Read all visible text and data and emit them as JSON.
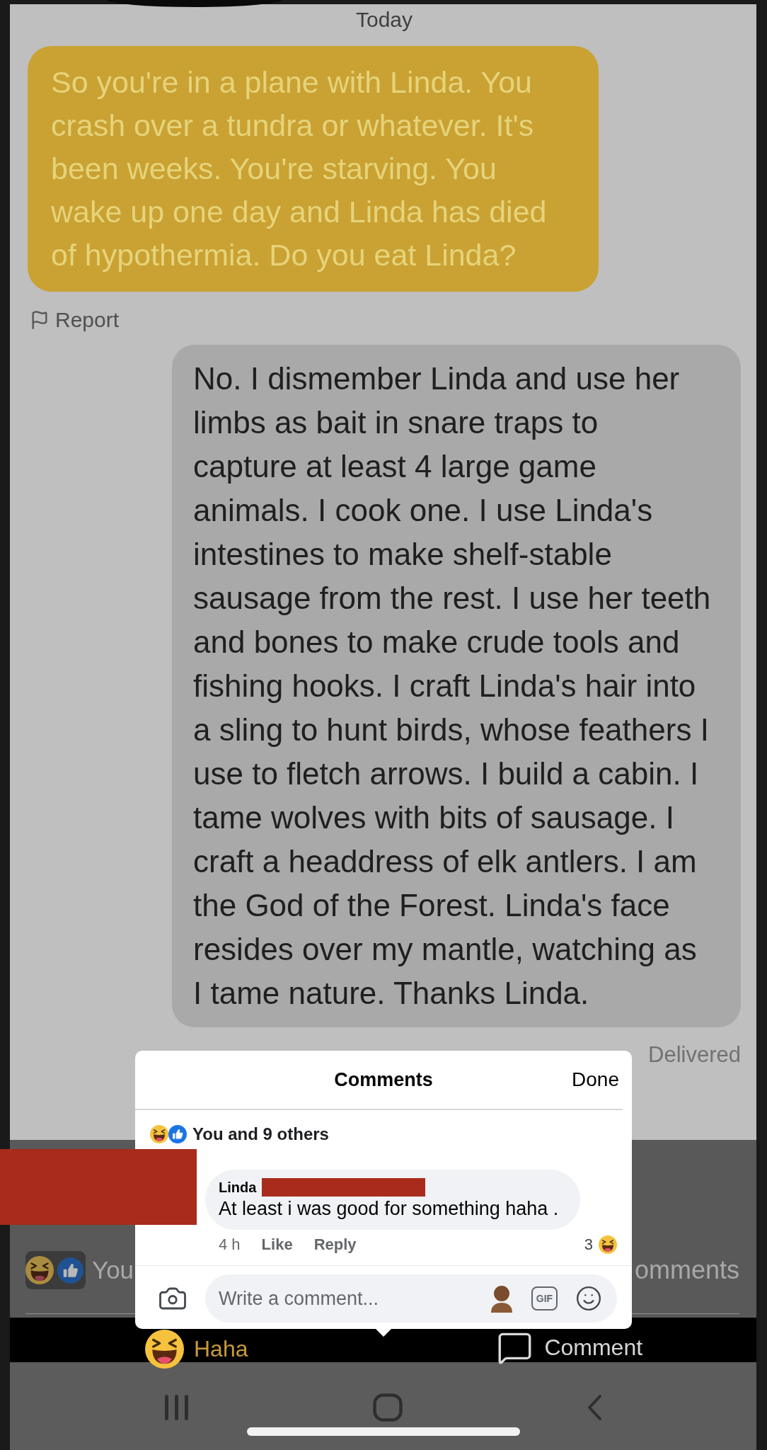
{
  "date_label": "Today",
  "messages": [
    {
      "kind": "received",
      "text": "So you're in a plane with Linda. You\ncrash over a tundra or whatever. It's\nbeen weeks. You're starving. You\nwake up one day and Linda has died\nof hypothermia. Do you eat Linda?",
      "action": "Report"
    },
    {
      "kind": "sent",
      "text": "No. I dismember Linda and use her\nlimbs as bait in snare traps to\ncapture at least 4 large game\nanimals. I cook one. I use Linda's\nintestines to make shelf-stable\nsausage from the rest. I use her teeth\nand bones to make crude tools and\nfishing hooks. I craft Linda's hair into\na sling to hunt birds, whose feathers I\nuse to fletch arrows. I build a cabin. I\ntame wolves with bits of sausage. I\ncraft a headdress of elk antlers. I am\nthe God of the Forest. Linda's face\nresides over my mantle, watching as\nI tame nature. Thanks Linda.",
      "status": "Delivered"
    }
  ],
  "comments_sheet": {
    "title": "Comments",
    "done": "Done",
    "reactions_summary": "You and 9 others",
    "comments": [
      {
        "author": "Linda",
        "text": "At least i was good for something haha .",
        "time": "4 h",
        "like": "Like",
        "reply": "Reply",
        "reaction_count": "3"
      }
    ],
    "composer": {
      "placeholder": "Write a comment...",
      "gif_label": "GIF"
    }
  },
  "post_footer": {
    "reactions_label": "You",
    "comments_label": "omments"
  },
  "actions": [
    {
      "kind": "haha",
      "label": "Haha",
      "selected": true
    },
    {
      "kind": "comment",
      "label": "Comment",
      "selected": false
    }
  ]
}
